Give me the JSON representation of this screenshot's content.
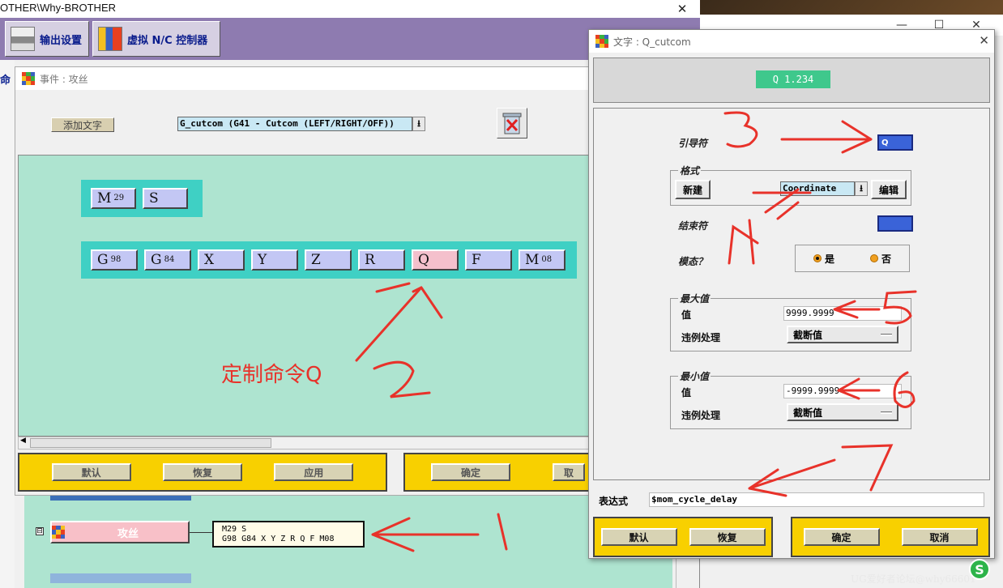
{
  "main_window": {
    "title": "OTHER\\Why-BROTHER",
    "close_glyph": "✕",
    "tabs": [
      {
        "label": "输出设置"
      },
      {
        "label": "虚拟 N/C 控制器"
      }
    ],
    "left_strip_label": "命"
  },
  "bg_window": {
    "minimize_glyph": "—",
    "maximize_glyph": "☐",
    "close_glyph": "✕"
  },
  "event_dialog": {
    "title": "事件 : 攻丝",
    "add_text_button": "添加文字",
    "command_select_value": "G_cutcom (G41 - Cutcom (LEFT/RIGHT/OFF))",
    "row1": [
      {
        "letter": "M",
        "sub": "29"
      },
      {
        "letter": "S",
        "sub": ""
      }
    ],
    "row2": [
      {
        "letter": "G",
        "sub": "98"
      },
      {
        "letter": "G",
        "sub": "84"
      },
      {
        "letter": "X",
        "sub": ""
      },
      {
        "letter": "Y",
        "sub": ""
      },
      {
        "letter": "Z",
        "sub": ""
      },
      {
        "letter": "R",
        "sub": ""
      },
      {
        "letter": "Q",
        "sub": "",
        "selected": true
      },
      {
        "letter": "F",
        "sub": ""
      },
      {
        "letter": "M",
        "sub": "08"
      }
    ],
    "annotation_note": "定制命令Q",
    "buttons_left": [
      "默认",
      "恢复",
      "应用"
    ],
    "buttons_right": [
      "确定",
      "取"
    ]
  },
  "event_list": {
    "tree_toggle": "⊟",
    "event_item_label": "攻丝",
    "preview_line1": "M29 S",
    "preview_line2": "G98 G84 X Y Z R Q F M08"
  },
  "text_dialog": {
    "title": "文字 : Q_cutcom",
    "close_glyph": "✕",
    "preview_text": "Q   1.234",
    "leader_label": "引导符",
    "leader_value": "Q",
    "format_group_label": "格式",
    "new_button": "新建",
    "format_value": "Coordinate",
    "edit_button": "编辑",
    "trailer_label": "结束符",
    "modal_label": "模态？",
    "modal_options": [
      {
        "label": "是",
        "checked": true
      },
      {
        "label": "否",
        "checked": false
      }
    ],
    "max_group_label": "最大值",
    "max_value_label": "值",
    "max_value": "9999.9999",
    "max_violation_label": "违例处理",
    "max_violation_value": "截断值",
    "min_group_label": "最小值",
    "min_value_label": "值",
    "min_value": "-9999.9999",
    "min_violation_label": "违例处理",
    "min_violation_value": "截断值",
    "expression_label": "表达式",
    "expression_value": "$mom_cycle_delay",
    "buttons_left": [
      "默认",
      "恢复"
    ],
    "buttons_right": [
      "确定",
      "取消"
    ]
  },
  "annotations": {
    "numbers": [
      "1",
      "2",
      "3",
      "4",
      "5",
      "6",
      "7"
    ],
    "color": "#e8322a"
  },
  "watermark": {
    "text": "UG爱好者论坛@why66601",
    "logo": "S"
  },
  "colors": {
    "purple_bar": "#8e7bb0",
    "green_area": "#aee4d0",
    "cyan_row": "#3fd0c4",
    "block_blue": "#c3c7f4",
    "block_pink": "#f4c0cc",
    "yellow_bar": "#f8d000",
    "preview_green": "#3fc88c",
    "field_blue": "#3a63d8"
  }
}
